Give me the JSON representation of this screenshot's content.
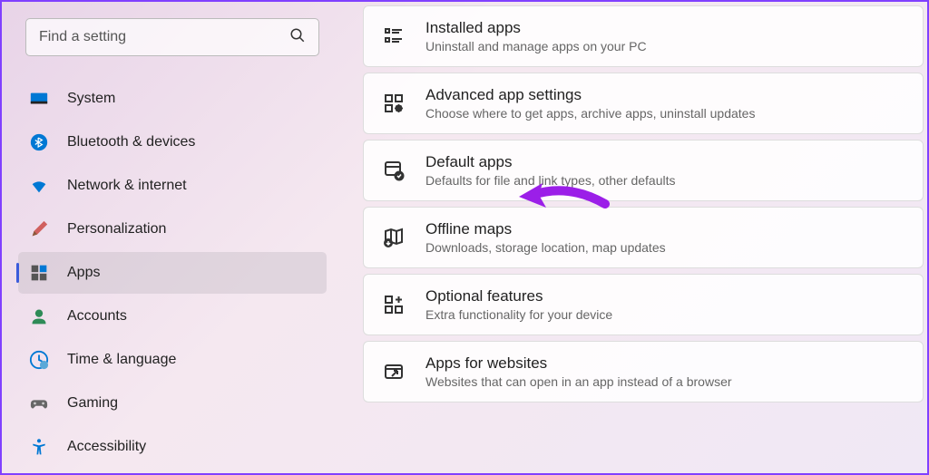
{
  "search": {
    "placeholder": "Find a setting"
  },
  "sidebar": {
    "items": [
      {
        "label": "System"
      },
      {
        "label": "Bluetooth & devices"
      },
      {
        "label": "Network & internet"
      },
      {
        "label": "Personalization"
      },
      {
        "label": "Apps"
      },
      {
        "label": "Accounts"
      },
      {
        "label": "Time & language"
      },
      {
        "label": "Gaming"
      },
      {
        "label": "Accessibility"
      }
    ]
  },
  "cards": [
    {
      "title": "Installed apps",
      "desc": "Uninstall and manage apps on your PC"
    },
    {
      "title": "Advanced app settings",
      "desc": "Choose where to get apps, archive apps, uninstall updates"
    },
    {
      "title": "Default apps",
      "desc": "Defaults for file and link types, other defaults"
    },
    {
      "title": "Offline maps",
      "desc": "Downloads, storage location, map updates"
    },
    {
      "title": "Optional features",
      "desc": "Extra functionality for your device"
    },
    {
      "title": "Apps for websites",
      "desc": "Websites that can open in an app instead of a browser"
    }
  ]
}
